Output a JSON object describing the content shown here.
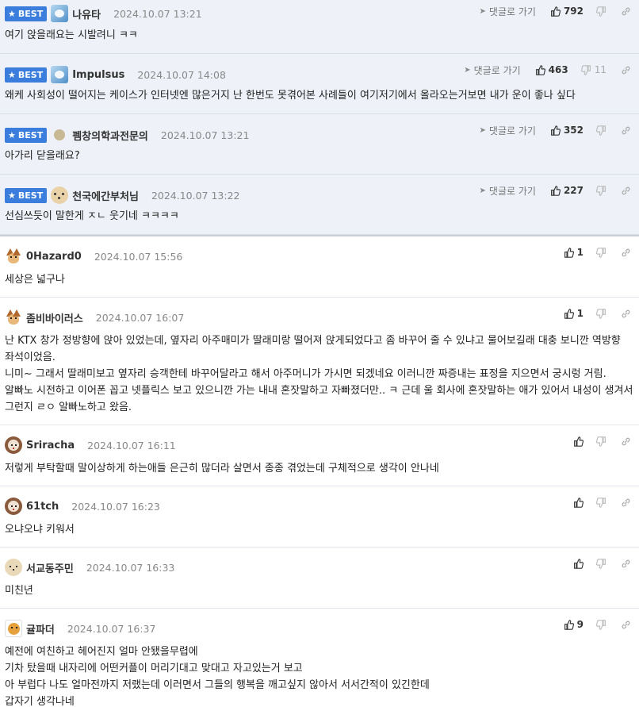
{
  "labels": {
    "best": "BEST",
    "reply": "댓글로 가기"
  },
  "comments": [
    {
      "best": true,
      "avatar": "bluebird",
      "nick": "나유타",
      "date": "2024.10.07 13:21",
      "up": "792",
      "down": "",
      "lines": [
        "여기 앉을래요는 시발려니 ㅋㅋ"
      ]
    },
    {
      "best": true,
      "avatar": "bluebird",
      "nick": "Impulsus",
      "date": "2024.10.07 14:08",
      "up": "463",
      "down": "11",
      "lines": [
        "왜케 사회성이 떨어지는 케이스가 인터넷엔 많은거지 난 한번도 못겪어본 사례들이 여기저기에서 올라오는거보면 내가 운이 좋나 싶다"
      ]
    },
    {
      "best": true,
      "avatar": "beige",
      "nick": "펨창의학과전문의",
      "date": "2024.10.07 13:21",
      "up": "352",
      "down": "",
      "lines": [
        "아가리 닫을래요?"
      ]
    },
    {
      "best": true,
      "avatar": "dog",
      "nick": "천국에간부처님",
      "date": "2024.10.07 13:22",
      "up": "227",
      "down": "",
      "lines": [
        "선심쓰듯이 말한게 ㅈㄴ 웃기네 ㅋㅋㅋㅋ"
      ]
    },
    {
      "best": false,
      "avatar": "fox",
      "nick": "0Hazard0",
      "date": "2024.10.07 15:56",
      "up": "1",
      "down": "",
      "lines": [
        "세상은 넓구나"
      ]
    },
    {
      "best": false,
      "avatar": "fox",
      "nick": "좀비바이러스",
      "date": "2024.10.07 16:07",
      "up": "1",
      "down": "",
      "lines": [
        "난 KTX 창가 정방향에 앉아 있었는데, 옆자리 아주매미가 딸래미랑 떨어져 앉게되었다고 좀 바꾸어 줄 수 있냐고 물어보길래 대충 보니깐 역방향 좌석이었음.",
        "니미~ 그래서 딸래미보고 옆자리 승객한테 바꾸어달라고 해서 아주머니가 가시면 되겠네요 이러니깐 짜증내는 표정을 지으면서 궁시렁 거림.",
        "알빠노 시전하고 이어폰 꼽고 넷플릭스 보고 있으니깐 가는 내내 혼잣말하고 자빠졌더만.. ㅋ 근데 울 회사에 혼잣말하는 애가 있어서 내성이 생겨서 그런지 ㄹㅇ 알빠노하고 왔음."
      ]
    },
    {
      "best": false,
      "avatar": "lion",
      "nick": "Sriracha",
      "date": "2024.10.07 16:11",
      "up": "",
      "down": "",
      "lines": [
        "저렇게 부탁할때 말이상하게 하는애들 은근히 많더라 살면서 종종 겪었는데 구체적으로 생각이 안나네"
      ]
    },
    {
      "best": false,
      "avatar": "lion",
      "nick": "61tch",
      "date": "2024.10.07 16:23",
      "up": "",
      "down": "",
      "lines": [
        "오냐오냐 키워서"
      ]
    },
    {
      "best": false,
      "avatar": "dog2",
      "nick": "서교동주민",
      "date": "2024.10.07 16:33",
      "up": "",
      "down": "",
      "lines": [
        "미친년"
      ]
    },
    {
      "best": false,
      "avatar": "tiger",
      "nick": "귤파더",
      "date": "2024.10.07 16:37",
      "up": "9",
      "down": "",
      "lines": [
        "예전에 여친하고 헤어진지 얼마 안됐을무렵에",
        "기차 탔을때 내자리에 어떤커플이 머리기대고 맞대고 자고있는거 보고",
        "아 부럽다 나도 얼마전까지 저랬는데 이러면서 그들의 행복을 깨고싶지 않아서 서서간적이 있긴한데",
        "갑자기 생각나네"
      ]
    }
  ]
}
